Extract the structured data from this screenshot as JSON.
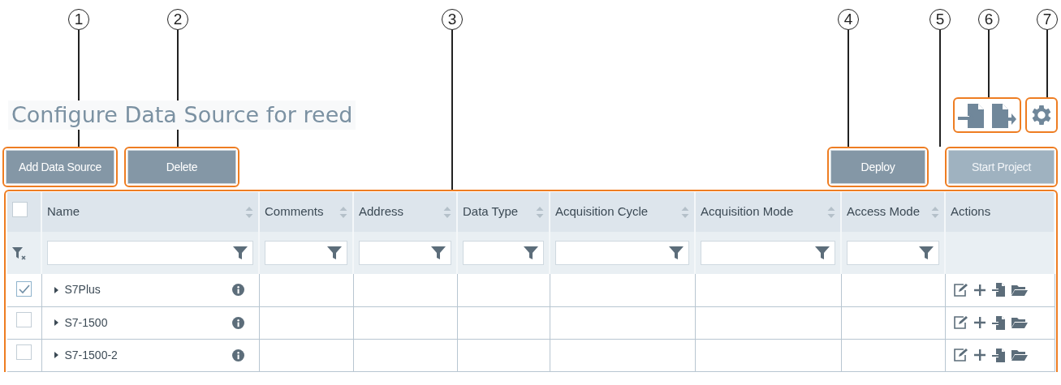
{
  "callouts": [
    {
      "number": "1"
    },
    {
      "number": "2"
    },
    {
      "number": "3"
    },
    {
      "number": "4"
    },
    {
      "number": "5"
    },
    {
      "number": "6"
    },
    {
      "number": "7"
    }
  ],
  "title": "Configure Data Source for reed",
  "left_buttons": [
    {
      "label": "Add Data Source",
      "disabled": false
    },
    {
      "label": "Delete",
      "disabled": false
    }
  ],
  "right_buttons": [
    {
      "label": "Deploy",
      "disabled": false
    },
    {
      "label": "Start Project",
      "disabled": true
    }
  ],
  "table": {
    "header_checked": false,
    "columns": [
      {
        "label": "Name",
        "sortable": true,
        "filterable": true
      },
      {
        "label": "Comments",
        "sortable": true,
        "filterable": true
      },
      {
        "label": "Address",
        "sortable": true,
        "filterable": true
      },
      {
        "label": "Data Type",
        "sortable": true,
        "filterable": true
      },
      {
        "label": "Acquisition Cycle",
        "sortable": true,
        "filterable": true
      },
      {
        "label": "Acquisition Mode",
        "sortable": true,
        "filterable": true
      },
      {
        "label": "Access Mode",
        "sortable": true,
        "filterable": true
      },
      {
        "label": "Actions",
        "sortable": false,
        "filterable": false
      }
    ],
    "rows": [
      {
        "name": "S7Plus",
        "checked": true,
        "expanded": false
      },
      {
        "name": "S7-1500",
        "checked": false,
        "expanded": false
      },
      {
        "name": "S7-1500-2",
        "checked": false,
        "expanded": false
      }
    ]
  }
}
